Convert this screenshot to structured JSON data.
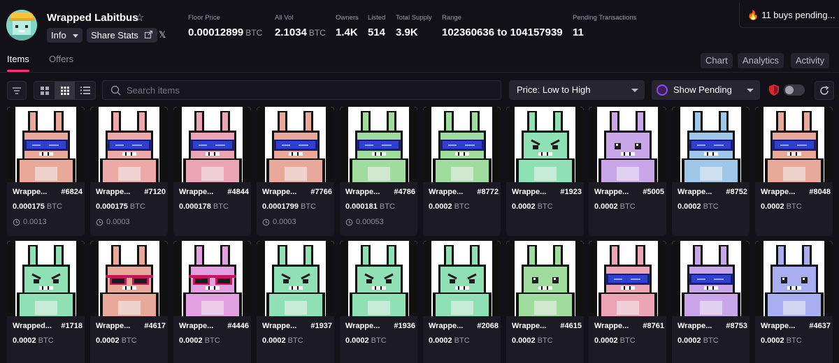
{
  "collection": {
    "name": "Wrapped Labitbus",
    "info_label": "Info",
    "share_label": "Share Stats",
    "x_label": "𝕏"
  },
  "stats": [
    {
      "label": "Floor Price",
      "value": "0.00012899",
      "unit": "BTC"
    },
    {
      "label": "All Vol",
      "value": "2.1034",
      "unit": "BTC"
    },
    {
      "label": "Owners",
      "value": "1.4K",
      "unit": ""
    },
    {
      "label": "Listed",
      "value": "514",
      "unit": ""
    },
    {
      "label": "Total Supply",
      "value": "3.9K",
      "unit": ""
    },
    {
      "label": "Range",
      "value": "102360636 to 104157939",
      "unit": ""
    },
    {
      "label": "Pending Transactions",
      "value": "11",
      "unit": ""
    }
  ],
  "pending_banner": "11 buys pending...",
  "tabs": {
    "items": "Items",
    "offers": "Offers"
  },
  "right_tabs": [
    "Chart",
    "Analytics",
    "Activity"
  ],
  "search": {
    "placeholder": "Search items"
  },
  "sort": {
    "selected": "Price: Low to High"
  },
  "filter": {
    "selected": "Show Pending"
  },
  "colors": {
    "accent": "#ff2f78",
    "background": "#121118",
    "card": "#1c1a22"
  },
  "items": [
    {
      "name": "Wrappe...",
      "id": "#6824",
      "price": "0.000175",
      "unit": "BTC",
      "last": "0.0013",
      "body": "#e8a99a",
      "accessory": "goggles",
      "face": "calm"
    },
    {
      "name": "Wrappe...",
      "id": "#7120",
      "price": "0.000175",
      "unit": "BTC",
      "last": "0.0003",
      "body": "#eda9a8",
      "accessory": "goggles",
      "face": "calm"
    },
    {
      "name": "Wrappe...",
      "id": "#4844",
      "price": "0.000178",
      "unit": "BTC",
      "last": "",
      "body": "#eba3b6",
      "accessory": "goggles",
      "face": "calm"
    },
    {
      "name": "Wrappe...",
      "id": "#7766",
      "price": "0.0001799",
      "unit": "BTC",
      "last": "0.0003",
      "body": "#e8a99a",
      "accessory": "goggles",
      "face": "calm"
    },
    {
      "name": "Wrappe...",
      "id": "#4786",
      "price": "0.000181",
      "unit": "BTC",
      "last": "0.00053",
      "body": "#9fdc9d",
      "accessory": "goggles",
      "face": "calm"
    },
    {
      "name": "Wrappe...",
      "id": "#8772",
      "price": "0.0002",
      "unit": "BTC",
      "last": "",
      "body": "#9fdc9d",
      "accessory": "goggles",
      "face": "calm"
    },
    {
      "name": "Wrappe...",
      "id": "#1923",
      "price": "0.0002",
      "unit": "BTC",
      "last": "",
      "body": "#8fe0b4",
      "accessory": "none",
      "face": "angry"
    },
    {
      "name": "Wrappe...",
      "id": "#5005",
      "price": "0.0002",
      "unit": "BTC",
      "last": "",
      "body": "#c9a6ea",
      "accessory": "none",
      "face": "calm"
    },
    {
      "name": "Wrappe...",
      "id": "#8752",
      "price": "0.0002",
      "unit": "BTC",
      "last": "",
      "body": "#9ec7ea",
      "accessory": "goggles",
      "face": "calm"
    },
    {
      "name": "Wrappe...",
      "id": "#8048",
      "price": "0.0002",
      "unit": "BTC",
      "last": "",
      "body": "#e8a99a",
      "accessory": "goggles",
      "face": "calm"
    },
    {
      "name": "Wrapped...",
      "id": "#1718",
      "price": "0.0002",
      "unit": "BTC",
      "last": "",
      "body": "#8fe0b4",
      "accessory": "none",
      "face": "angry"
    },
    {
      "name": "Wrappe...",
      "id": "#4617",
      "price": "0.0002",
      "unit": "BTC",
      "last": "",
      "body": "#e8a99a",
      "accessory": "sunglasses",
      "face": "calm"
    },
    {
      "name": "Wrappe...",
      "id": "#4446",
      "price": "0.0002",
      "unit": "BTC",
      "last": "",
      "body": "#e2a0e0",
      "accessory": "sunglasses",
      "face": "calm"
    },
    {
      "name": "Wrappe...",
      "id": "#1937",
      "price": "0.0002",
      "unit": "BTC",
      "last": "",
      "body": "#8fe0b4",
      "accessory": "none",
      "face": "angry"
    },
    {
      "name": "Wrappe...",
      "id": "#1936",
      "price": "0.0002",
      "unit": "BTC",
      "last": "",
      "body": "#8fe0b4",
      "accessory": "none",
      "face": "angry"
    },
    {
      "name": "Wrappe...",
      "id": "#2068",
      "price": "0.0002",
      "unit": "BTC",
      "last": "",
      "body": "#8fe0b4",
      "accessory": "none",
      "face": "angry"
    },
    {
      "name": "Wrappe...",
      "id": "#4615",
      "price": "0.0002",
      "unit": "BTC",
      "last": "",
      "body": "#9fdc9d",
      "accessory": "none",
      "face": "calm"
    },
    {
      "name": "Wrappe...",
      "id": "#8761",
      "price": "0.0002",
      "unit": "BTC",
      "last": "",
      "body": "#eba3b6",
      "accessory": "goggles",
      "face": "calm"
    },
    {
      "name": "Wrappe...",
      "id": "#8753",
      "price": "0.0002",
      "unit": "BTC",
      "last": "",
      "body": "#c9a6ea",
      "accessory": "goggles",
      "face": "calm"
    },
    {
      "name": "Wrappe...",
      "id": "#4637",
      "price": "0.0002",
      "unit": "BTC",
      "last": "",
      "body": "#a9aef0",
      "accessory": "none",
      "face": "calm"
    }
  ]
}
